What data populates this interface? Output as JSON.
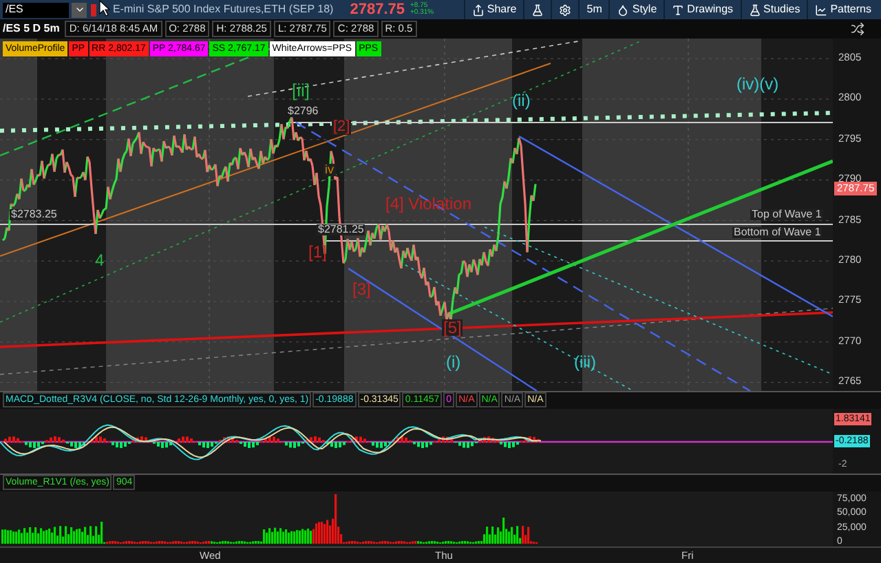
{
  "toolbar": {
    "symbol": "/ES",
    "title": "E-mini S&P 500 Index Futures,ETH (SEP 18)",
    "price": "2787.75",
    "change": "+8.75",
    "change_pct": "+0.31%",
    "buttons": [
      {
        "kind": "share",
        "label": "Share"
      },
      {
        "kind": "flask"
      },
      {
        "kind": "gear"
      },
      {
        "kind": "interval",
        "label": "5m"
      },
      {
        "kind": "style",
        "label": "Style"
      },
      {
        "kind": "drawings",
        "label": "Drawings"
      },
      {
        "kind": "studies",
        "label": "Studies"
      },
      {
        "kind": "patterns",
        "label": "Patterns"
      }
    ]
  },
  "info_bar": {
    "symbol": "/ES 5 D 5m",
    "fields": [
      "D: 6/14/18 8:45 AM",
      "O: 2788",
      "H: 2788.25",
      "L: 2787.75",
      "C: 2788",
      "R: 0.5"
    ]
  },
  "legend": [
    {
      "label": "VolumeProfile",
      "color": "#e8b400"
    },
    {
      "label": "PP",
      "color": "#ff1a1a"
    },
    {
      "label": "RR 2,802.17",
      "color": "#ff1a1a"
    },
    {
      "label": "PP 2,784.67",
      "color": "#ff00ff"
    },
    {
      "label": "SS 2,767.17",
      "color": "#00e000"
    },
    {
      "label": "WhiteArrows=PPS",
      "color": "#ffffff"
    },
    {
      "label": "PPS",
      "color": "#00e000"
    }
  ],
  "price_chart": {
    "annotations": [
      {
        "text": "$2783.25",
        "color": "#c8c8c8"
      },
      {
        "text": "4",
        "color": "#22bb44"
      },
      {
        "text": "[ii]",
        "color": "#22bb44"
      },
      {
        "text": "$2796",
        "color": "#c8c8c8"
      },
      {
        "text": "[2]",
        "color": "#cc2020"
      },
      {
        "text": "iv",
        "color": "#cc8800"
      },
      {
        "text": "[4] Violation",
        "color": "#cc2020"
      },
      {
        "text": "$2781.25",
        "color": "#c8c8c8"
      },
      {
        "text": "[1]",
        "color": "#cc2020"
      },
      {
        "text": "[3]",
        "color": "#cc2020"
      },
      {
        "text": "[5]",
        "color": "#cc2020"
      },
      {
        "text": "(i)",
        "color": "#33cccc"
      },
      {
        "text": "(ii)",
        "color": "#33cccc"
      },
      {
        "text": "(iii)",
        "color": "#33cccc"
      },
      {
        "text": "(iv)(v)",
        "color": "#33cccc"
      },
      {
        "text": "Top of Wave 1",
        "color": "#c8c8c8"
      },
      {
        "text": "Bottom of Wave 1",
        "color": "#c8c8c8"
      }
    ],
    "axis_labels": [
      "2805",
      "2800",
      "2795",
      "2790",
      "2785",
      "2780",
      "2775",
      "2770",
      "2765"
    ],
    "last_price": "2787.75"
  },
  "macd": {
    "title": "MACD_Dotted_R3V4 (CLOSE, no, Std 12-26-9 Monthly, yes, 0, yes, 1)",
    "values": [
      "-0.19888",
      "-0.31345",
      "0.11457",
      "0",
      "N/A",
      "N/A",
      "N/A",
      "N/A"
    ],
    "axis_labels": [
      {
        "text": "1.83141",
        "kind": "badge",
        "color": "#f06060"
      },
      {
        "text": "-0.2188",
        "kind": "badge",
        "color": "#33dddd"
      },
      {
        "text": "-2",
        "kind": "plain",
        "color": "#aaaaaa"
      }
    ]
  },
  "volume": {
    "title": "Volume_R1V1 (/es, yes)",
    "value": "904",
    "axis_labels": [
      "75,000",
      "50,000",
      "25,000",
      "0"
    ]
  },
  "time_axis": [
    "Wed",
    "Thu",
    "Fri"
  ]
}
